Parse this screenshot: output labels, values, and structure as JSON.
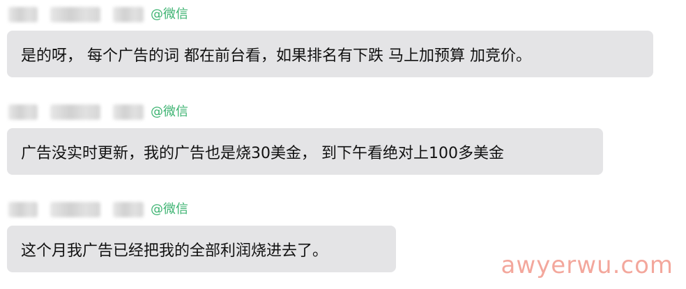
{
  "messages": [
    {
      "sender_tag": "@微信",
      "text": "是的呀，  每个广告的词 都在前台看，如果排名有下跌  马上加预算  加竞价。"
    },
    {
      "sender_tag": "@微信",
      "text": "广告没实时更新，我的广告也是烧30美金，  到下午看绝对上100多美金"
    },
    {
      "sender_tag": "@微信",
      "text": "这个月我广告已经把我的全部利润烧进去了。"
    }
  ],
  "watermark": "awyerwu.com"
}
